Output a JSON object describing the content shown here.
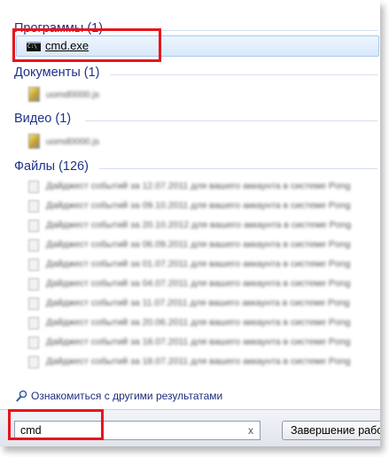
{
  "groups": {
    "programs": {
      "header": "Программы (1)",
      "items": [
        {
          "label": "cmd.exe",
          "icon": "cmd-console-icon"
        }
      ]
    },
    "documents": {
      "header": "Документы (1)",
      "items": [
        {
          "label": "uomd0000.js"
        }
      ]
    },
    "video": {
      "header": "Видео (1)",
      "items": [
        {
          "label": "uomd0000.js"
        }
      ]
    },
    "files": {
      "header": "Файлы (126)",
      "items": [
        {
          "label": "Дайджест событий за 12.07.2011 для вашего аккаунта в системе Pong"
        },
        {
          "label": "Дайджест событий за 09.10.2011 для вашего аккаунта в системе Pong"
        },
        {
          "label": "Дайджест событий за 20.10.2012 для вашего аккаунта в системе Pong"
        },
        {
          "label": "Дайджест событий за 06.09.2011 для вашего аккаунта в системе Pong"
        },
        {
          "label": "Дайджест событий за 01.07.2011 для вашего аккаунта в системе Pong"
        },
        {
          "label": "Дайджест событий за 04.07.2011 для вашего аккаунта в системе Pong"
        },
        {
          "label": "Дайджест событий за 11.07.2011 для вашего аккаунта в системе Pong"
        },
        {
          "label": "Дайджест событий за 20.06.2011 для вашего аккаунта в системе Pong"
        },
        {
          "label": "Дайджест событий за 18.07.2011 для вашего аккаунта в системе Pong"
        },
        {
          "label": "Дайджест событий за 18.07.2011 для вашего аккаунта в системе Pong"
        }
      ]
    }
  },
  "more_results": {
    "label": "Ознакомиться с другими результатами",
    "icon": "magnifier-icon"
  },
  "search": {
    "value": "cmd",
    "clear_label": "x"
  },
  "shutdown": {
    "label": "Завершение работы"
  },
  "colors": {
    "header_text": "#1e3287",
    "selected_bg": "#dce9fb",
    "highlight_border": "#e8141c"
  }
}
